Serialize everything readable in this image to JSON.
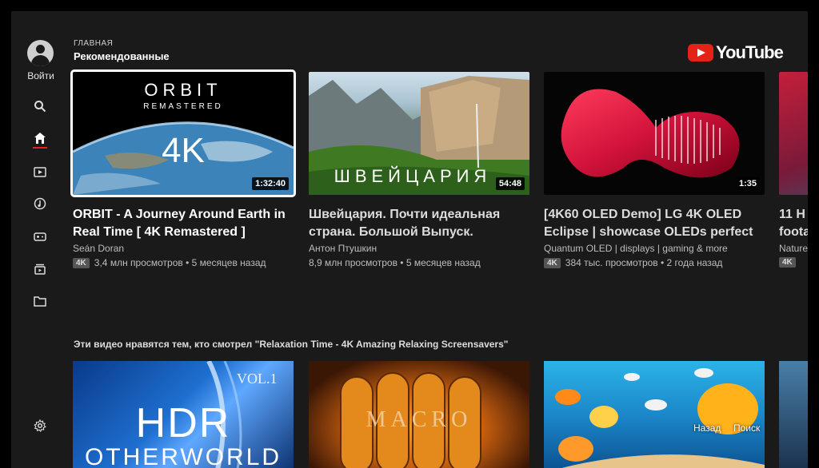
{
  "sidebar": {
    "signin_label": "Войти",
    "icons": [
      "search-icon",
      "home-icon",
      "subscriptions-icon",
      "music-icon",
      "gaming-icon",
      "queue-icon",
      "folder-icon",
      "settings-icon"
    ]
  },
  "header": {
    "section_small": "ГЛАВНАЯ",
    "section_title": "Рекомендованные",
    "logo_text": "YouTube"
  },
  "colors": {
    "accent": "#e62117",
    "background": "#1a1a1a"
  },
  "videos": [
    {
      "thumb_title": "ORBIT",
      "thumb_subtitle": "REMASTERED",
      "thumb_big": "4K",
      "duration": "1:32:40",
      "title": "ORBIT - A Journey Around Earth in Real Time [ 4K Remastered ]",
      "channel": "Seán Doran",
      "badge": "4K",
      "stats": "3,4 млн просмотров • 5 месяцев назад"
    },
    {
      "thumb_text": "ШВЕЙЦАРИЯ",
      "duration": "54:48",
      "title": "Швейцария. Почти идеальная страна. Большой Выпуск.",
      "channel": "Антон Птушкин",
      "stats": "8,9 млн просмотров • 5 месяцев назад"
    },
    {
      "duration": "1:35",
      "title": "[4K60 OLED Demo] LG 4K OLED Eclipse | showcase OLEDs perfect",
      "channel": "Quantum OLED | displays | gaming & more",
      "badge": "4K",
      "stats": "384 тыс. просмотров • 2 года назад"
    },
    {
      "title": "11 H foota",
      "channel": "Nature",
      "badge": "4K"
    }
  ],
  "row2": {
    "label": "Эти видео нравятся тем, кто смотрел \"Relaxation Time - 4K Amazing Relaxing Screensavers\"",
    "thumbs": [
      {
        "big": "HDR",
        "big2": "OTHERWORLD",
        "vol": "VOL.1"
      },
      {
        "big": "MACRO"
      },
      {}
    ],
    "hint_back": "Назад",
    "hint_search": "Поиск"
  }
}
